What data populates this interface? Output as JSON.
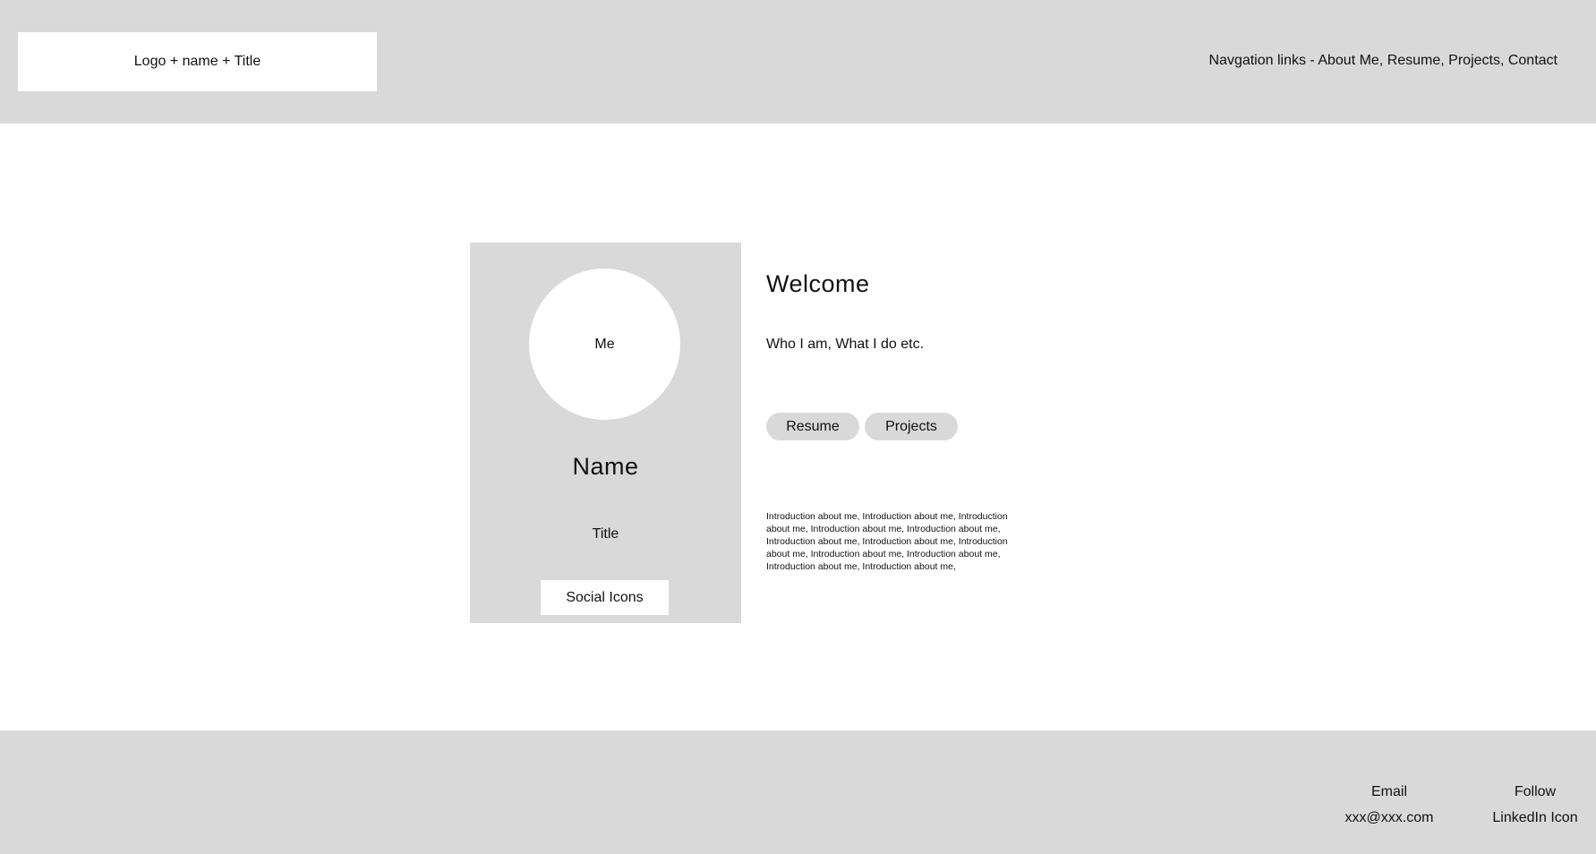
{
  "header": {
    "logo_text": "Logo + name + Title",
    "nav_text": "Navgation links -  About Me, Resume, Projects, Contact"
  },
  "profile_card": {
    "avatar_label": "Me",
    "name": "Name",
    "title": "Title",
    "social_label": "Social Icons"
  },
  "main": {
    "heading": "Welcome",
    "subheading": "Who I am, What I do etc.",
    "buttons": [
      {
        "label": "Resume"
      },
      {
        "label": "Projects"
      }
    ],
    "intro_text": "Introduction about me, Introduction about me, Introduction about me, Introduction about me, Introduction about me, Introduction about me, Introduction about me, Introduction about me, Introduction about me, Introduction about me, Introduction about me, Introduction about me,"
  },
  "footer": {
    "email_heading": "Email",
    "email_value": "xxx@xxx.com",
    "follow_heading": "Follow",
    "follow_value": "LinkedIn Icon"
  },
  "colors": {
    "panel_gray": "#d9d9d9",
    "background": "#ffffff",
    "text": "#111111"
  }
}
